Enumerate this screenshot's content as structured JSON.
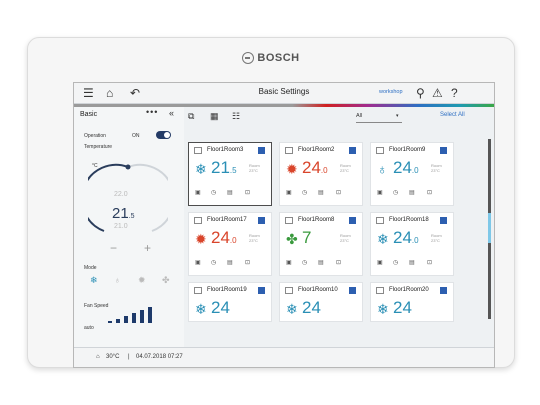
{
  "brand": {
    "name": "BOSCH"
  },
  "topbar": {
    "title": "Basic Settings",
    "workspace_label": "workshop",
    "icons": [
      "menu-icon",
      "home-icon",
      "back-icon",
      "user-icon",
      "warning-icon",
      "help-icon"
    ]
  },
  "toolbar": {
    "filter_value": "All",
    "select_all_label": "Select All",
    "icons": [
      "fit-icon",
      "grid-view-icon",
      "list-view-icon"
    ]
  },
  "left_panel": {
    "title": "Basic",
    "operation_label": "Operation",
    "operation_value": "ON",
    "temperature_label": "Temperature",
    "unit_label": "°C",
    "setpoint_upper": "22.0",
    "setpoint_lower": "21.0",
    "current_integer": "21",
    "current_decimal": ".5",
    "minus_label": "−",
    "plus_label": "+",
    "mode_label": "Mode",
    "fan_speed_label": "Fan Speed",
    "fan_speed_value": "auto",
    "mode_icons": [
      "cool-icon",
      "dry-icon",
      "heat-icon",
      "fan-icon"
    ]
  },
  "tiles": [
    {
      "name": "Floor1Room3",
      "mode": "cool",
      "integer": "21",
      "decimal": ".5",
      "room_label": "Room",
      "room_temp": "23°C",
      "color": "#2a8fb5"
    },
    {
      "name": "Floor1Room2",
      "mode": "heat",
      "integer": "24",
      "decimal": ".0",
      "room_label": "Room",
      "room_temp": "23°C",
      "color": "#d9452b"
    },
    {
      "name": "Floor1Room9",
      "mode": "dry",
      "integer": "24",
      "decimal": ".0",
      "room_label": "Room",
      "room_temp": "23°C",
      "color": "#2a8fb5"
    },
    {
      "name": "Floor1Room17",
      "mode": "heat",
      "integer": "24",
      "decimal": ".0",
      "room_label": "Room",
      "room_temp": "23°C",
      "color": "#d9452b"
    },
    {
      "name": "Floor1Room8",
      "mode": "fan",
      "integer": "7",
      "decimal": "",
      "room_label": "Room",
      "room_temp": "23°C",
      "color": "#3a9a3e"
    },
    {
      "name": "Floor1Room18",
      "mode": "cool",
      "integer": "24",
      "decimal": ".0",
      "room_label": "Room",
      "room_temp": "23°C",
      "color": "#2a8fb5"
    },
    {
      "name": "Floor1Room19",
      "mode": "cool",
      "integer": "24",
      "decimal": "",
      "room_label": "",
      "room_temp": "",
      "color": "#2a8fb5"
    },
    {
      "name": "Floor1Room10",
      "mode": "cool",
      "integer": "24",
      "decimal": "",
      "room_label": "",
      "room_temp": "",
      "color": "#2a8fb5"
    },
    {
      "name": "Floor1Room20",
      "mode": "cool",
      "integer": "24",
      "decimal": "",
      "room_label": "",
      "room_temp": "",
      "color": "#2a8fb5"
    }
  ],
  "status_bar": {
    "outdoor_temp": "30°C",
    "separator": "|",
    "datetime": "04.07.2018 07:27"
  },
  "colors": {
    "accent_blue": "#2d6fc3",
    "cool": "#2a8fb5",
    "heat": "#d9452b",
    "fan": "#3a9a3e",
    "toggle": "#243b66"
  }
}
